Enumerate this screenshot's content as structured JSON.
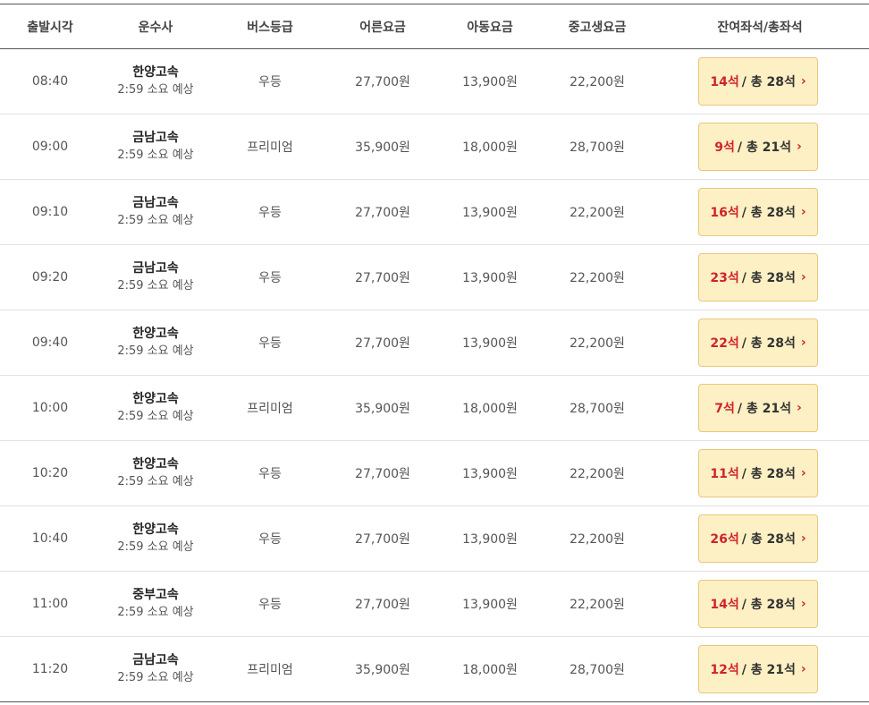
{
  "headers": {
    "time": "출발시각",
    "company": "운수사",
    "grade": "버스등급",
    "adult": "어른요금",
    "child": "아동요금",
    "student": "중고생요금",
    "seats": "잔여좌석/총좌석"
  },
  "rows": [
    {
      "time": "08:40",
      "company": "한양고속",
      "duration": "2:59 소요 예상",
      "grade": "우등",
      "adult": "27,700원",
      "child": "13,900원",
      "student": "22,200원",
      "remain": "14석",
      "total": "/ 총 28석"
    },
    {
      "time": "09:00",
      "company": "금남고속",
      "duration": "2:59 소요 예상",
      "grade": "프리미엄",
      "adult": "35,900원",
      "child": "18,000원",
      "student": "28,700원",
      "remain": "9석",
      "total": "/ 총 21석"
    },
    {
      "time": "09:10",
      "company": "금남고속",
      "duration": "2:59 소요 예상",
      "grade": "우등",
      "adult": "27,700원",
      "child": "13,900원",
      "student": "22,200원",
      "remain": "16석",
      "total": "/ 총 28석"
    },
    {
      "time": "09:20",
      "company": "금남고속",
      "duration": "2:59 소요 예상",
      "grade": "우등",
      "adult": "27,700원",
      "child": "13,900원",
      "student": "22,200원",
      "remain": "23석",
      "total": "/ 총 28석"
    },
    {
      "time": "09:40",
      "company": "한양고속",
      "duration": "2:59 소요 예상",
      "grade": "우등",
      "adult": "27,700원",
      "child": "13,900원",
      "student": "22,200원",
      "remain": "22석",
      "total": "/ 총 28석"
    },
    {
      "time": "10:00",
      "company": "한양고속",
      "duration": "2:59 소요 예상",
      "grade": "프리미엄",
      "adult": "35,900원",
      "child": "18,000원",
      "student": "28,700원",
      "remain": "7석",
      "total": "/ 총 21석"
    },
    {
      "time": "10:20",
      "company": "한양고속",
      "duration": "2:59 소요 예상",
      "grade": "우등",
      "adult": "27,700원",
      "child": "13,900원",
      "student": "22,200원",
      "remain": "11석",
      "total": "/ 총 28석"
    },
    {
      "time": "10:40",
      "company": "한양고속",
      "duration": "2:59 소요 예상",
      "grade": "우등",
      "adult": "27,700원",
      "child": "13,900원",
      "student": "22,200원",
      "remain": "26석",
      "total": "/ 총 28석"
    },
    {
      "time": "11:00",
      "company": "중부고속",
      "duration": "2:59 소요 예상",
      "grade": "우등",
      "adult": "27,700원",
      "child": "13,900원",
      "student": "22,200원",
      "remain": "14석",
      "total": "/ 총 28석"
    },
    {
      "time": "11:20",
      "company": "금남고속",
      "duration": "2:59 소요 예상",
      "grade": "프리미엄",
      "adult": "35,900원",
      "child": "18,000원",
      "student": "28,700원",
      "remain": "12석",
      "total": "/ 총 21석"
    }
  ],
  "icons": {
    "seat_button_arrow": "chevron-right-icon"
  },
  "colors": {
    "accent_red": "#d0232a",
    "button_bg": "#fdf0c4",
    "button_border": "#e8c77d"
  }
}
